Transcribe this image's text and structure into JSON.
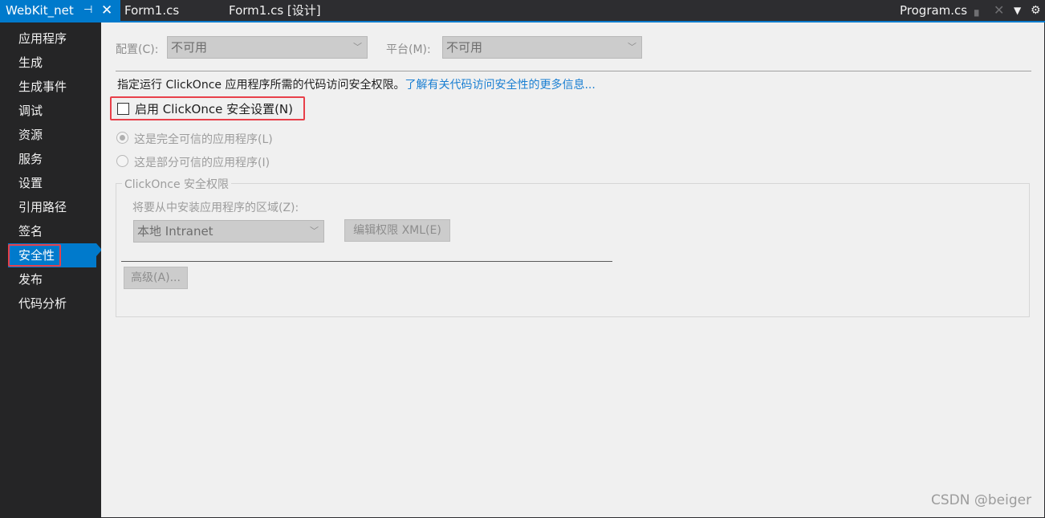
{
  "tabs": {
    "active": {
      "label": "WebKit_net",
      "pin_icon": "pin-icon",
      "close_icon": "close-icon"
    },
    "others": [
      {
        "label": "Form1.cs"
      },
      {
        "label": "Form1.cs [设计]"
      },
      {
        "label": "Program.cs"
      }
    ]
  },
  "sidebar": {
    "items": [
      {
        "label": "应用程序"
      },
      {
        "label": "生成"
      },
      {
        "label": "生成事件"
      },
      {
        "label": "调试"
      },
      {
        "label": "资源"
      },
      {
        "label": "服务"
      },
      {
        "label": "设置"
      },
      {
        "label": "引用路径"
      },
      {
        "label": "签名"
      },
      {
        "label": "安全性",
        "selected": true
      },
      {
        "label": "发布"
      },
      {
        "label": "代码分析"
      }
    ]
  },
  "main": {
    "config_label": "配置(C):",
    "config_value": "不可用",
    "platform_label": "平台(M):",
    "platform_value": "不可用",
    "description": "指定运行 ClickOnce 应用程序所需的代码访问安全权限。",
    "description_link": "了解有关代码访问安全性的更多信息...",
    "enable_checkbox_label": "启用 ClickOnce 安全设置(N)",
    "enable_checked": false,
    "radio_full_trust": "这是完全可信的应用程序(L)",
    "radio_partial_trust": "这是部分可信的应用程序(I)",
    "group_title": "ClickOnce 安全权限",
    "zone_label": "将要从中安装应用程序的区域(Z):",
    "zone_value": "本地 Intranet",
    "edit_xml_button": "编辑权限 XML(E)",
    "advanced_button": "高级(A)..."
  },
  "watermark": "CSDN @beiger",
  "colors": {
    "accent": "#007acc",
    "highlight_border": "#e8404a",
    "link": "#1a7fd2"
  }
}
